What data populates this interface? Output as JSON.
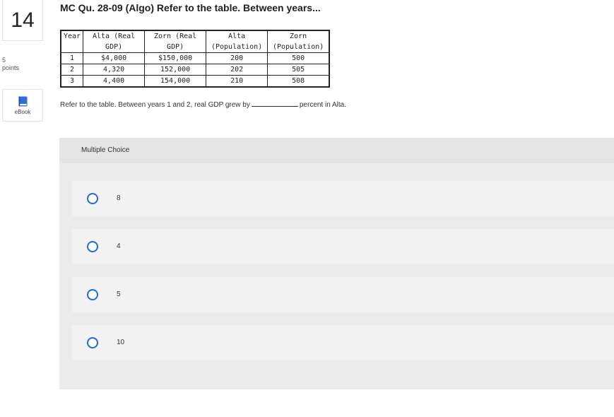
{
  "question": {
    "number": "14",
    "points_value": "5",
    "points_label": "points",
    "ebook_label": "eBook",
    "title": "MC Qu. 28-09 (Algo) Refer to the table. Between years...",
    "text_before_blank": "Refer to the table. Between years 1 and 2, real GDP grew by",
    "text_after_blank": "percent in Alta."
  },
  "table": {
    "headers": [
      [
        "Year"
      ],
      [
        "Alta (Real",
        "GDP)"
      ],
      [
        "Zorn (Real",
        "GDP)"
      ],
      [
        "Alta",
        "(Population)"
      ],
      [
        "Zorn",
        "(Population)"
      ]
    ],
    "rows": [
      [
        "1",
        "$4,000",
        "$150,000",
        "200",
        "500"
      ],
      [
        "2",
        "4,320",
        "152,000",
        "202",
        "505"
      ],
      [
        "3",
        "4,400",
        "154,000",
        "210",
        "508"
      ]
    ]
  },
  "multiple_choice": {
    "header": "Multiple Choice",
    "options": [
      "8",
      "4",
      "5",
      "10"
    ]
  },
  "colors": {
    "radio_accent": "#1f6ad8",
    "book_icon": "#2e6fd6"
  }
}
